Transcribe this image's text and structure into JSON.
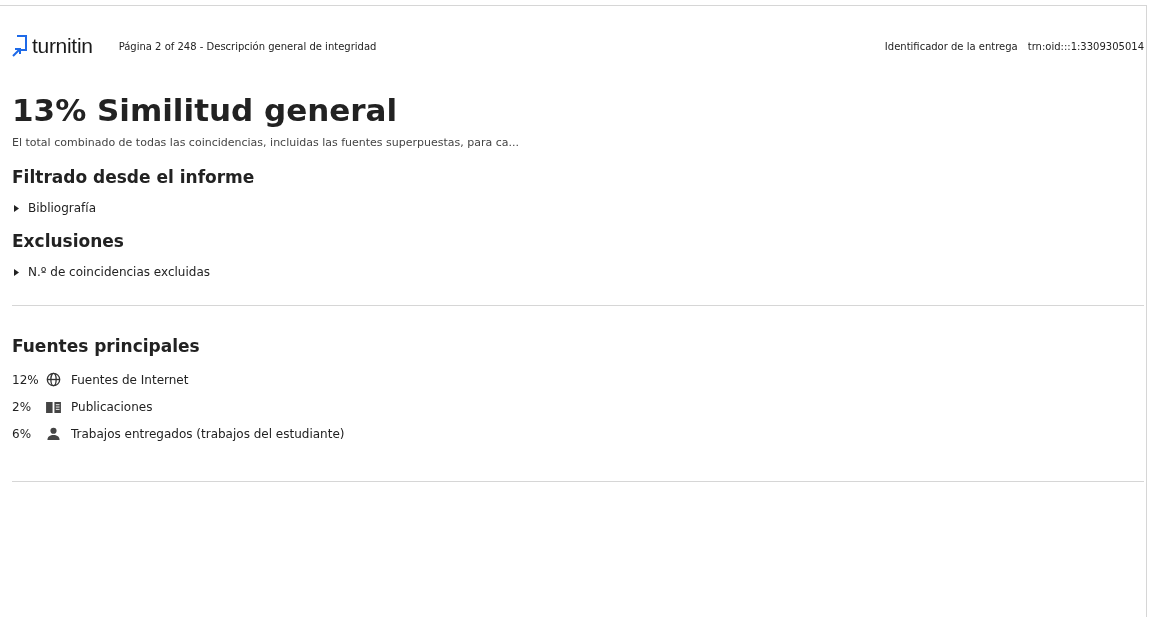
{
  "header": {
    "logo": "turnitin",
    "page_info": "Página 2 of 248 - Descripción general de integridad",
    "submission_label": "Identificador de la entrega",
    "submission_id": "trn:oid:::1:3309305014"
  },
  "title": "13% Similitud general",
  "subtitle": "El total combinado de todas las coincidencias, incluidas las fuentes superpuestas, para ca...",
  "sections": [
    {
      "heading": "Filtrado desde el informe",
      "items": [
        "Bibliografía"
      ]
    },
    {
      "heading": "Exclusiones",
      "items": [
        "N.º de coincidencias excluidas"
      ]
    }
  ],
  "top_sources": {
    "heading": "Fuentes principales",
    "rows": [
      {
        "percent": "12%",
        "kind": "internet",
        "label": "Fuentes de Internet"
      },
      {
        "percent": "2%",
        "kind": "publication",
        "label": "Publicaciones"
      },
      {
        "percent": "6%",
        "kind": "submitted",
        "label": "Trabajos entregados (trabajos del estudiante)"
      }
    ]
  }
}
